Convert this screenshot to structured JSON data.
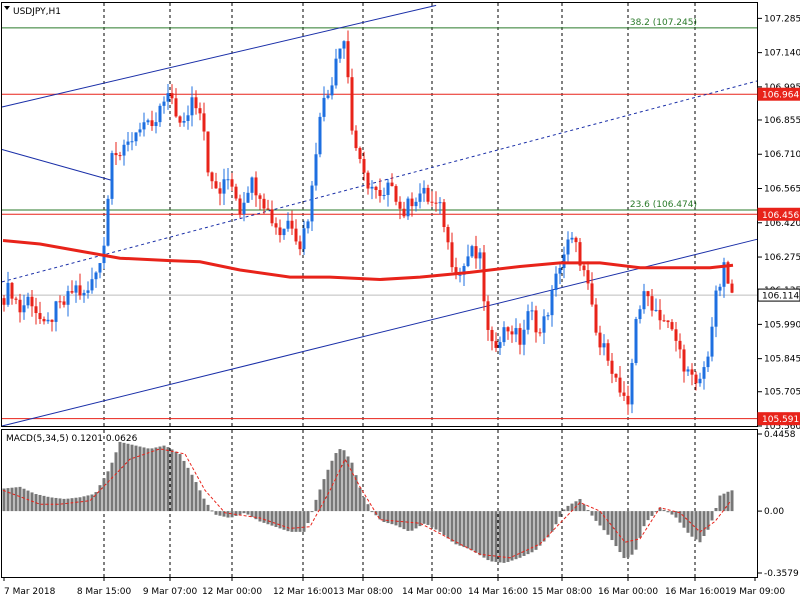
{
  "window": {
    "symbol_title": "USDJPY,H1"
  },
  "colors": {
    "bull": "#1e6fe0",
    "bear": "#e8231a",
    "ma": "#e8231a",
    "fib": "#2a7a2a",
    "hline": "#e8231a",
    "channel": "#1a2fa8",
    "macd_hist": "#777777",
    "macd_signal": "#e8231a",
    "grid": "#000000"
  },
  "chart_data": [
    {
      "type": "candlestick",
      "title": "USDJPY,H1",
      "ylim": [
        105.56,
        107.35
      ],
      "y_ticks": [
        "107.285",
        "107.140",
        "106.995",
        "106.855",
        "106.710",
        "106.565",
        "106.420",
        "106.275",
        "106.135",
        "105.990",
        "105.845",
        "105.705",
        "105.560"
      ],
      "x_ticks": [
        "7 Mar 2018",
        "8 Mar 15:00",
        "9 Mar 07:00",
        "12 Mar 00:00",
        "12 Mar 16:00",
        "13 Mar 08:00",
        "14 Mar 00:00",
        "14 Mar 16:00",
        "15 Mar 08:00",
        "16 Mar 00:00",
        "16 Mar 16:00",
        "19 Mar 09:00"
      ],
      "price_path": [
        [
          0,
          106.08
        ],
        [
          10,
          106.15
        ],
        [
          20,
          106.05
        ],
        [
          30,
          106.11
        ],
        [
          45,
          105.96
        ],
        [
          55,
          106.05
        ],
        [
          65,
          106.08
        ],
        [
          75,
          106.15
        ],
        [
          85,
          106.1
        ],
        [
          95,
          106.2
        ],
        [
          105,
          106.35
        ],
        [
          112,
          106.75
        ],
        [
          122,
          106.7
        ],
        [
          132,
          106.78
        ],
        [
          142,
          106.85
        ],
        [
          152,
          106.8
        ],
        [
          162,
          106.92
        ],
        [
          172,
          106.95
        ],
        [
          182,
          106.8
        ],
        [
          192,
          106.95
        ],
        [
          202,
          106.9
        ],
        [
          210,
          106.58
        ],
        [
          220,
          106.55
        ],
        [
          230,
          106.62
        ],
        [
          240,
          106.48
        ],
        [
          250,
          106.6
        ],
        [
          260,
          106.55
        ],
        [
          270,
          106.45
        ],
        [
          280,
          106.38
        ],
        [
          290,
          106.44
        ],
        [
          300,
          106.33
        ],
        [
          310,
          106.48
        ],
        [
          320,
          106.9
        ],
        [
          330,
          106.98
        ],
        [
          338,
          107.18
        ],
        [
          345,
          107.2
        ],
        [
          352,
          106.82
        ],
        [
          362,
          106.62
        ],
        [
          372,
          106.57
        ],
        [
          382,
          106.5
        ],
        [
          392,
          106.6
        ],
        [
          402,
          106.45
        ],
        [
          412,
          106.52
        ],
        [
          422,
          106.55
        ],
        [
          432,
          106.5
        ],
        [
          442,
          106.47
        ],
        [
          450,
          106.28
        ],
        [
          460,
          106.2
        ],
        [
          470,
          106.3
        ],
        [
          480,
          106.26
        ],
        [
          490,
          105.87
        ],
        [
          500,
          105.95
        ],
        [
          510,
          105.98
        ],
        [
          520,
          105.92
        ],
        [
          530,
          106.05
        ],
        [
          540,
          105.95
        ],
        [
          550,
          106.08
        ],
        [
          560,
          106.25
        ],
        [
          570,
          106.35
        ],
        [
          578,
          106.3
        ],
        [
          588,
          106.14
        ],
        [
          598,
          105.9
        ],
        [
          608,
          105.87
        ],
        [
          618,
          105.72
        ],
        [
          628,
          105.62
        ],
        [
          636,
          106.03
        ],
        [
          646,
          106.12
        ],
        [
          656,
          106.05
        ],
        [
          666,
          106.0
        ],
        [
          676,
          105.92
        ],
        [
          686,
          105.8
        ],
        [
          696,
          105.72
        ],
        [
          706,
          105.82
        ],
        [
          716,
          106.1
        ],
        [
          724,
          106.22
        ],
        [
          732,
          106.11
        ]
      ],
      "ma_path": [
        [
          3,
          106.345
        ],
        [
          40,
          106.33
        ],
        [
          80,
          106.3
        ],
        [
          120,
          106.27
        ],
        [
          170,
          106.26
        ],
        [
          200,
          106.255
        ],
        [
          240,
          106.22
        ],
        [
          290,
          106.19
        ],
        [
          330,
          106.19
        ],
        [
          380,
          106.18
        ],
        [
          420,
          106.19
        ],
        [
          470,
          106.21
        ],
        [
          520,
          106.235
        ],
        [
          560,
          106.25
        ],
        [
          600,
          106.25
        ],
        [
          640,
          106.23
        ],
        [
          680,
          106.23
        ],
        [
          710,
          106.23
        ],
        [
          733,
          106.24
        ]
      ],
      "horizontal_levels": [
        {
          "label": "106.964",
          "value": 106.964,
          "kind": "line"
        },
        {
          "label": "106.456",
          "value": 106.456,
          "kind": "line"
        },
        {
          "label": "106.114",
          "value": 106.114,
          "kind": "price"
        },
        {
          "label": "105.591",
          "value": 105.591,
          "kind": "line"
        }
      ],
      "fib_levels": [
        {
          "text": "38.2 (107.245)",
          "value": 107.245
        },
        {
          "text": "23.6 (106.474)",
          "value": 106.474
        }
      ],
      "channel_lines": [
        {
          "x1_frac": 0.0,
          "y1": 106.91,
          "x2_frac": 0.575,
          "y2": 107.34,
          "style": "solid"
        },
        {
          "x1_frac": 0.0,
          "y1": 106.17,
          "x2_frac": 1.0,
          "y2": 107.02,
          "style": "dashed"
        },
        {
          "x1_frac": 0.0,
          "y1": 105.56,
          "x2_frac": 1.0,
          "y2": 106.35,
          "style": "solid"
        },
        {
          "x1_frac": 0.0,
          "y1": 106.73,
          "x2_frac": 0.145,
          "y2": 106.6,
          "style": "solid"
        }
      ],
      "vertical_gridlines_at_ticks": true
    },
    {
      "type": "bar",
      "title": "MACD(5,34,5) 0.1201 0.0626",
      "ylim": [
        -0.3579,
        0.4458
      ],
      "y_ticks": [
        "0.4458",
        "0.00",
        "-0.3579"
      ],
      "histogram_path": [
        [
          3,
          0.13
        ],
        [
          20,
          0.14
        ],
        [
          35,
          0.1
        ],
        [
          50,
          0.08
        ],
        [
          65,
          0.07
        ],
        [
          80,
          0.08
        ],
        [
          95,
          0.1
        ],
        [
          110,
          0.25
        ],
        [
          120,
          0.4
        ],
        [
          135,
          0.38
        ],
        [
          150,
          0.36
        ],
        [
          165,
          0.38
        ],
        [
          180,
          0.33
        ],
        [
          195,
          0.18
        ],
        [
          205,
          0.06
        ],
        [
          215,
          -0.02
        ],
        [
          230,
          -0.04
        ],
        [
          245,
          -0.01
        ],
        [
          260,
          -0.06
        ],
        [
          275,
          -0.09
        ],
        [
          290,
          -0.12
        ],
        [
          305,
          -0.12
        ],
        [
          315,
          0.05
        ],
        [
          325,
          0.2
        ],
        [
          335,
          0.33
        ],
        [
          342,
          0.37
        ],
        [
          352,
          0.28
        ],
        [
          362,
          0.1
        ],
        [
          372,
          0.0
        ],
        [
          382,
          -0.06
        ],
        [
          395,
          -0.08
        ],
        [
          410,
          -0.12
        ],
        [
          425,
          -0.07
        ],
        [
          440,
          -0.12
        ],
        [
          455,
          -0.19
        ],
        [
          470,
          -0.22
        ],
        [
          490,
          -0.29
        ],
        [
          505,
          -0.3
        ],
        [
          520,
          -0.27
        ],
        [
          535,
          -0.23
        ],
        [
          550,
          -0.14
        ],
        [
          565,
          0.02
        ],
        [
          580,
          0.07
        ],
        [
          595,
          -0.05
        ],
        [
          610,
          -0.15
        ],
        [
          625,
          -0.28
        ],
        [
          635,
          -0.24
        ],
        [
          645,
          -0.07
        ],
        [
          660,
          0.02
        ],
        [
          675,
          -0.03
        ],
        [
          690,
          -0.14
        ],
        [
          700,
          -0.18
        ],
        [
          710,
          -0.09
        ],
        [
          720,
          0.09
        ],
        [
          731,
          0.12
        ]
      ],
      "signal_path": [
        [
          3,
          0.12
        ],
        [
          40,
          0.04
        ],
        [
          60,
          0.04
        ],
        [
          90,
          0.06
        ],
        [
          110,
          0.18
        ],
        [
          130,
          0.3
        ],
        [
          160,
          0.36
        ],
        [
          185,
          0.33
        ],
        [
          205,
          0.12
        ],
        [
          225,
          -0.01
        ],
        [
          260,
          -0.04
        ],
        [
          290,
          -0.1
        ],
        [
          310,
          -0.09
        ],
        [
          330,
          0.12
        ],
        [
          345,
          0.3
        ],
        [
          360,
          0.14
        ],
        [
          380,
          -0.05
        ],
        [
          420,
          -0.07
        ],
        [
          450,
          -0.16
        ],
        [
          480,
          -0.25
        ],
        [
          510,
          -0.27
        ],
        [
          540,
          -0.19
        ],
        [
          565,
          -0.04
        ],
        [
          580,
          0.05
        ],
        [
          600,
          0.0
        ],
        [
          625,
          -0.18
        ],
        [
          640,
          -0.16
        ],
        [
          660,
          0.02
        ],
        [
          680,
          -0.01
        ],
        [
          700,
          -0.12
        ],
        [
          715,
          -0.06
        ],
        [
          731,
          0.06
        ]
      ]
    }
  ]
}
